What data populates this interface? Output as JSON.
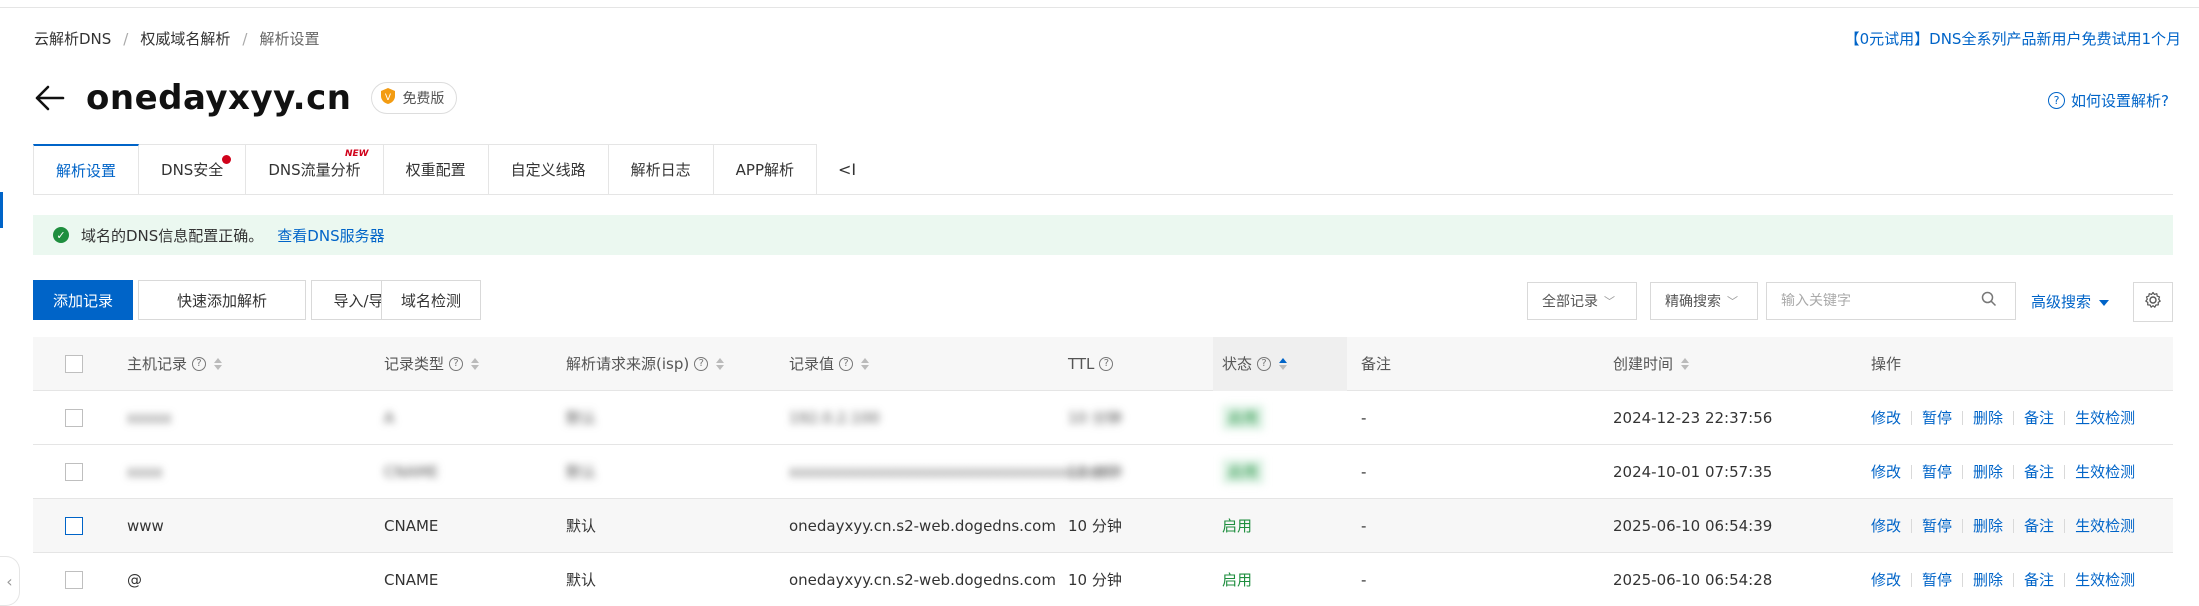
{
  "breadcrumb": [
    "云解析DNS",
    "权威域名解析",
    "解析设置"
  ],
  "promo": "【0元试用】DNS全系列产品新用户免费试用1个月",
  "domain": "onedayxyy.cn",
  "badge": "免费版",
  "help": "如何设置解析?",
  "tabs": [
    {
      "label": "解析设置"
    },
    {
      "label": "DNS安全"
    },
    {
      "label": "DNS流量分析",
      "tag": "NEW"
    },
    {
      "label": "权重配置"
    },
    {
      "label": "自定义线路"
    },
    {
      "label": "解析日志"
    },
    {
      "label": "APP解析"
    }
  ],
  "tab_collapse": "<I",
  "alert": {
    "message": "域名的DNS信息配置正确。",
    "link": "查看DNS服务器"
  },
  "toolbar": {
    "add": "添加记录",
    "quick_add": "快速添加解析",
    "import_export": "导入/导出",
    "check": "域名检测",
    "filter_all": "全部记录",
    "filter_mode": "精确搜索",
    "search_placeholder": "输入关键字",
    "advanced": "高级搜索"
  },
  "table": {
    "headers": {
      "host": "主机记录",
      "type": "记录类型",
      "isp": "解析请求来源(isp)",
      "value": "记录值",
      "ttl": "TTL",
      "status": "状态",
      "remark": "备注",
      "created": "创建时间",
      "ops": "操作"
    },
    "rows": [
      {
        "host": "xxxxx",
        "type": "A",
        "isp": "默认",
        "value": "192.0.2.100",
        "ttl": "10 分钟",
        "status": "启用",
        "remark": "-",
        "created": "2024-12-23 22:37:56",
        "blurred": true
      },
      {
        "host": "xxxx",
        "type": "CNAME",
        "isp": "默认",
        "value": "xxxxxxxxxxxxxxxxxxxxxxxxxxxxxxxx.com",
        "ttl": "10 分钟",
        "status": "启用",
        "remark": "-",
        "created": "2024-10-01 07:57:35",
        "blurred": true
      },
      {
        "host": "www",
        "type": "CNAME",
        "isp": "默认",
        "value": "onedayxyy.cn.s2-web.dogedns.com",
        "ttl": "10 分钟",
        "status": "启用",
        "remark": "-",
        "created": "2025-06-10 06:54:39",
        "blurred": false
      },
      {
        "host": "@",
        "type": "CNAME",
        "isp": "默认",
        "value": "onedayxyy.cn.s2-web.dogedns.com",
        "ttl": "10 分钟",
        "status": "启用",
        "remark": "-",
        "created": "2025-06-10 06:54:28",
        "blurred": false
      }
    ],
    "actions": [
      "修改",
      "暂停",
      "删除",
      "备注",
      "生效检测"
    ]
  },
  "colors": {
    "primary": "#0064c8",
    "success": "#1e8e3e",
    "alert_bg": "#ebf8f0",
    "dot": "#d0021b"
  }
}
